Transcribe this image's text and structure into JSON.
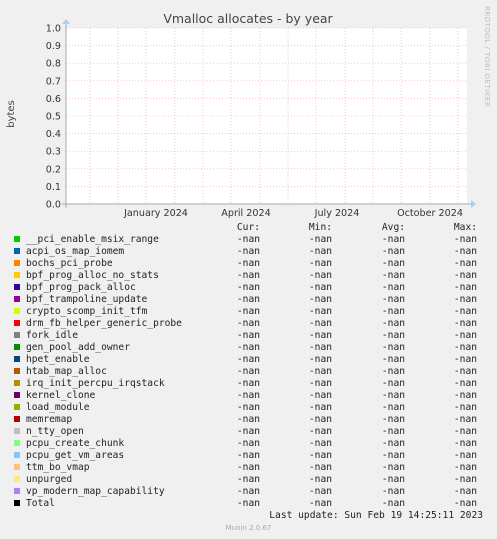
{
  "chart_data": {
    "type": "line",
    "title": "Vmalloc allocates - by year",
    "ylabel": "bytes",
    "xlabel": "",
    "ylim": [
      0,
      1
    ],
    "yticks": [
      "0.0",
      "0.1",
      "0.2",
      "0.3",
      "0.4",
      "0.5",
      "0.6",
      "0.7",
      "0.8",
      "0.9",
      "1.0"
    ],
    "xticks": [
      "January 2024",
      "April 2024",
      "July 2024",
      "October 2024"
    ],
    "grid": true,
    "series": []
  },
  "watermark": "RRDTOOL / TOBI OETIKER",
  "legend": {
    "headers": {
      "cur": "Cur:",
      "min": "Min:",
      "avg": "Avg:",
      "max": "Max:"
    },
    "items": [
      {
        "name": "__pci_enable_msix_range",
        "color": "#00cc00",
        "cur": "-nan",
        "min": "-nan",
        "avg": "-nan",
        "max": "-nan"
      },
      {
        "name": "acpi_os_map_iomem",
        "color": "#0066b3",
        "cur": "-nan",
        "min": "-nan",
        "avg": "-nan",
        "max": "-nan"
      },
      {
        "name": "bochs_pci_probe",
        "color": "#ff8000",
        "cur": "-nan",
        "min": "-nan",
        "avg": "-nan",
        "max": "-nan"
      },
      {
        "name": "bpf_prog_alloc_no_stats",
        "color": "#ffcc00",
        "cur": "-nan",
        "min": "-nan",
        "avg": "-nan",
        "max": "-nan"
      },
      {
        "name": "bpf_prog_pack_alloc",
        "color": "#330099",
        "cur": "-nan",
        "min": "-nan",
        "avg": "-nan",
        "max": "-nan"
      },
      {
        "name": "bpf_trampoline_update",
        "color": "#990099",
        "cur": "-nan",
        "min": "-nan",
        "avg": "-nan",
        "max": "-nan"
      },
      {
        "name": "crypto_scomp_init_tfm",
        "color": "#ccff00",
        "cur": "-nan",
        "min": "-nan",
        "avg": "-nan",
        "max": "-nan"
      },
      {
        "name": "drm_fb_helper_generic_probe",
        "color": "#ff0000",
        "cur": "-nan",
        "min": "-nan",
        "avg": "-nan",
        "max": "-nan"
      },
      {
        "name": "fork_idle",
        "color": "#808080",
        "cur": "-nan",
        "min": "-nan",
        "avg": "-nan",
        "max": "-nan"
      },
      {
        "name": "gen_pool_add_owner",
        "color": "#008f00",
        "cur": "-nan",
        "min": "-nan",
        "avg": "-nan",
        "max": "-nan"
      },
      {
        "name": "hpet_enable",
        "color": "#00487d",
        "cur": "-nan",
        "min": "-nan",
        "avg": "-nan",
        "max": "-nan"
      },
      {
        "name": "htab_map_alloc",
        "color": "#b35a00",
        "cur": "-nan",
        "min": "-nan",
        "avg": "-nan",
        "max": "-nan"
      },
      {
        "name": "irq_init_percpu_irqstack",
        "color": "#b38f00",
        "cur": "-nan",
        "min": "-nan",
        "avg": "-nan",
        "max": "-nan"
      },
      {
        "name": "kernel_clone",
        "color": "#6b006b",
        "cur": "-nan",
        "min": "-nan",
        "avg": "-nan",
        "max": "-nan"
      },
      {
        "name": "load_module",
        "color": "#8fb300",
        "cur": "-nan",
        "min": "-nan",
        "avg": "-nan",
        "max": "-nan"
      },
      {
        "name": "memremap",
        "color": "#b30000",
        "cur": "-nan",
        "min": "-nan",
        "avg": "-nan",
        "max": "-nan"
      },
      {
        "name": "n_tty_open",
        "color": "#bebebe",
        "cur": "-nan",
        "min": "-nan",
        "avg": "-nan",
        "max": "-nan"
      },
      {
        "name": "pcpu_create_chunk",
        "color": "#80ff80",
        "cur": "-nan",
        "min": "-nan",
        "avg": "-nan",
        "max": "-nan"
      },
      {
        "name": "pcpu_get_vm_areas",
        "color": "#80c9ff",
        "cur": "-nan",
        "min": "-nan",
        "avg": "-nan",
        "max": "-nan"
      },
      {
        "name": "ttm_bo_vmap",
        "color": "#ffc080",
        "cur": "-nan",
        "min": "-nan",
        "avg": "-nan",
        "max": "-nan"
      },
      {
        "name": "unpurged",
        "color": "#ffe680",
        "cur": "-nan",
        "min": "-nan",
        "avg": "-nan",
        "max": "-nan"
      },
      {
        "name": "vp_modern_map_capability",
        "color": "#aa80ff",
        "cur": "-nan",
        "min": "-nan",
        "avg": "-nan",
        "max": "-nan"
      },
      {
        "name": "Total",
        "color": "#000000",
        "cur": "-nan",
        "min": "-nan",
        "avg": "-nan",
        "max": "-nan"
      }
    ]
  },
  "last_update": "Last update: Sun Feb 19 14:25:11 2023",
  "footer": "Munin 2.0.67"
}
